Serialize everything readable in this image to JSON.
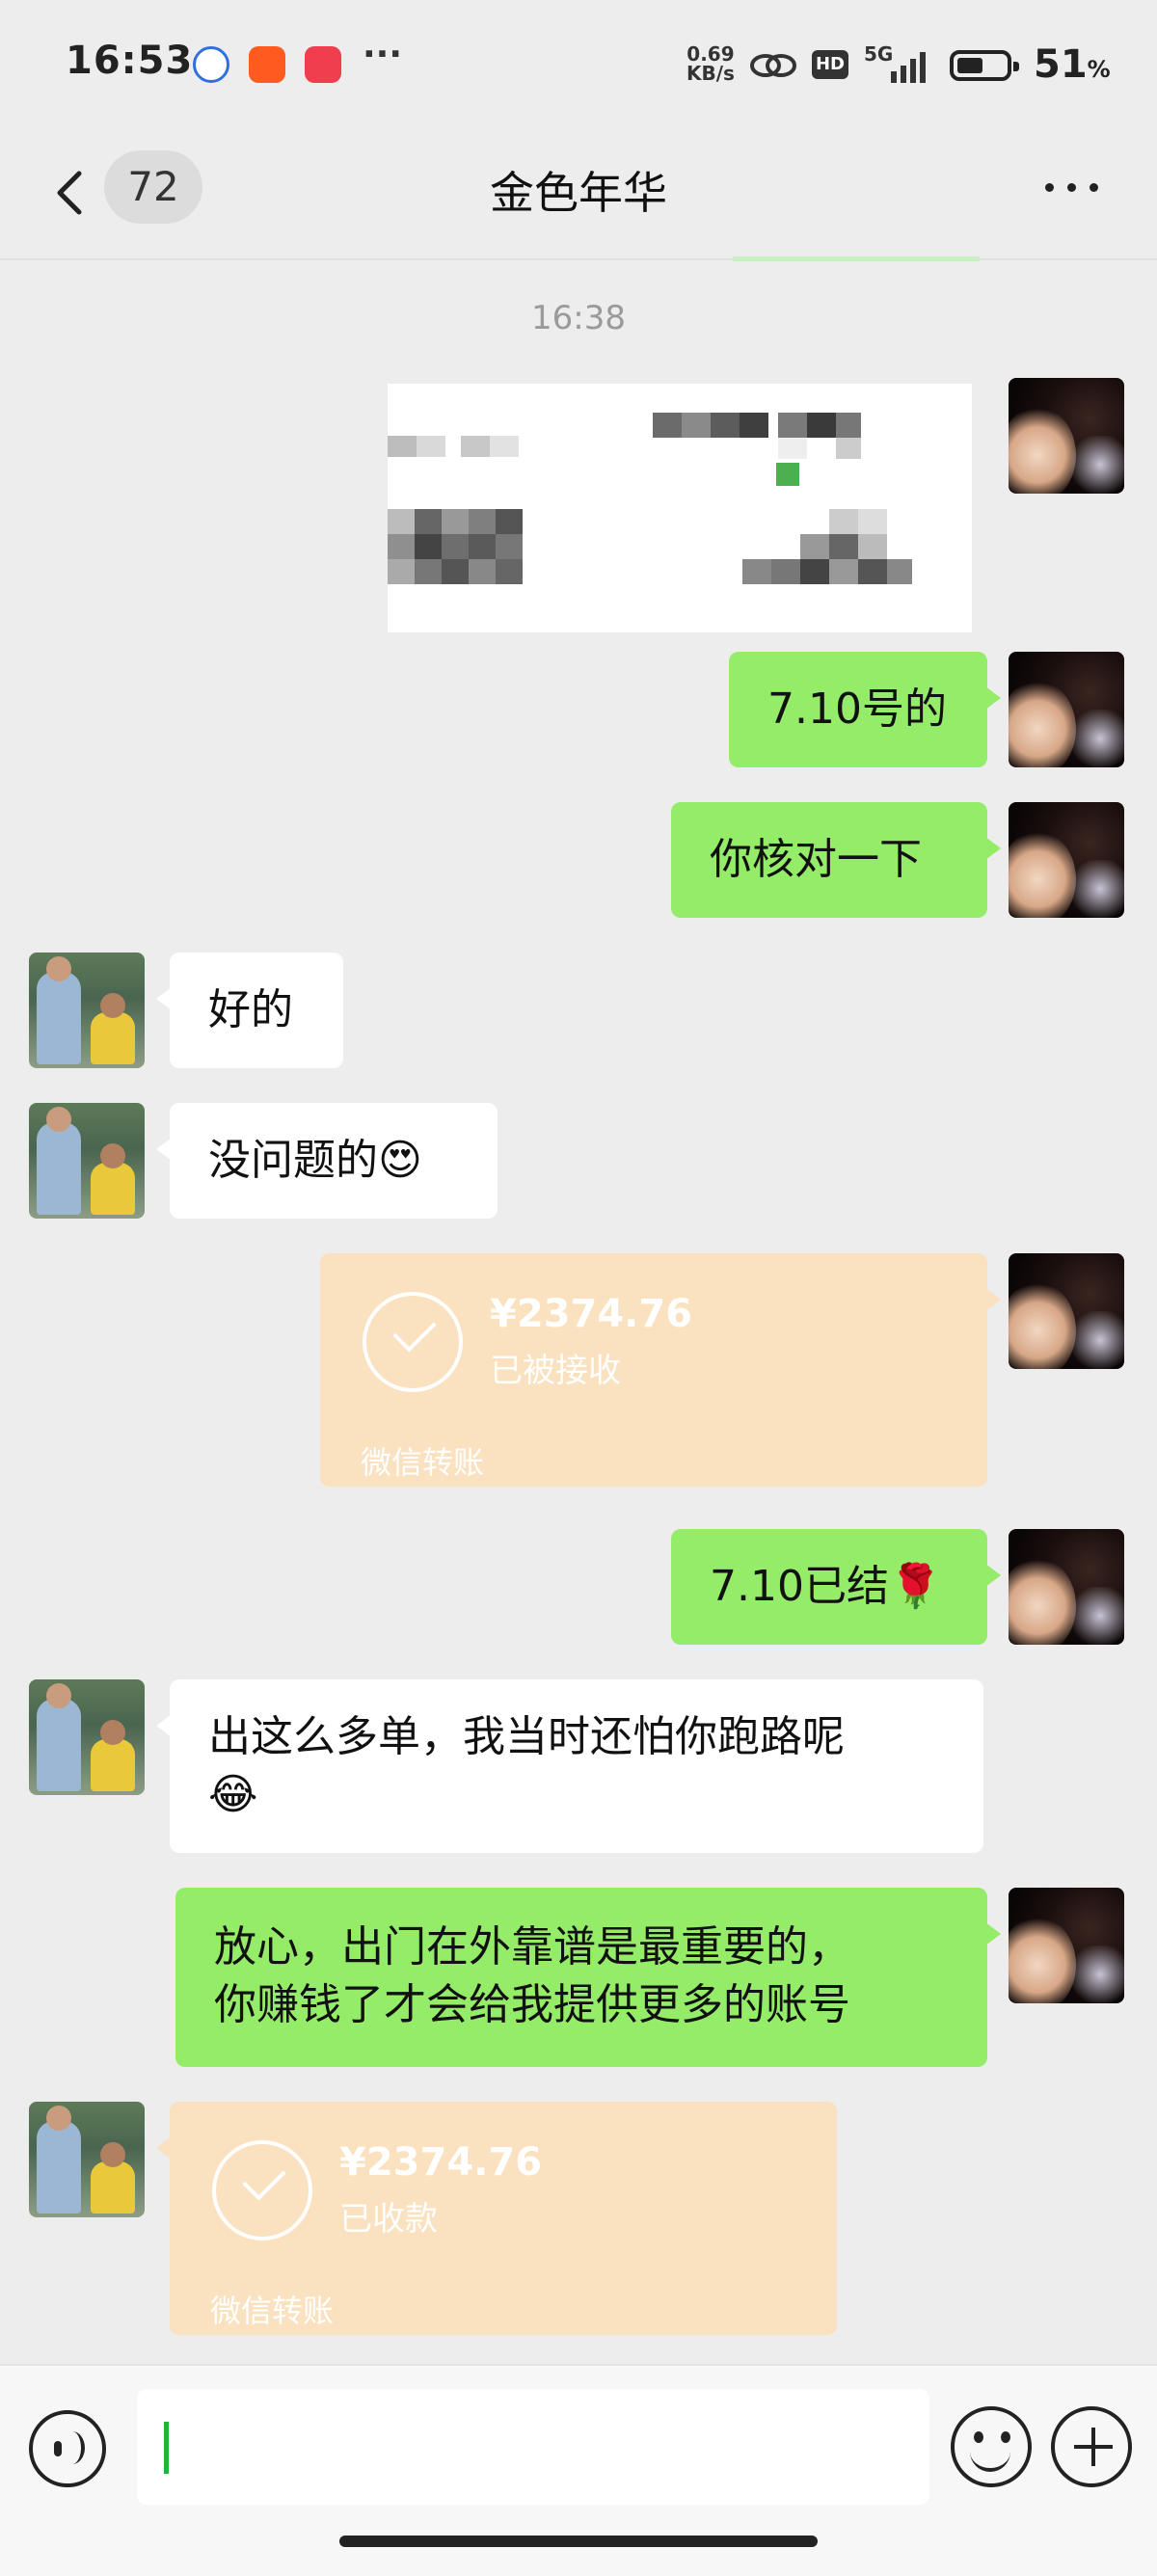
{
  "status_bar": {
    "time": "16:53",
    "more": "···",
    "net_speed": "0.69",
    "net_unit": "KB/s",
    "hd": "HD",
    "signal": "5G",
    "battery_pct": "51",
    "battery_unit": "%"
  },
  "nav": {
    "unread_count": "72",
    "title": "金色年华"
  },
  "chat": {
    "timestamp": "16:38",
    "messages": [
      {
        "sender": "me",
        "type": "image"
      },
      {
        "sender": "me",
        "type": "text",
        "text": "7.10号的"
      },
      {
        "sender": "me",
        "type": "text",
        "text": "你核对一下"
      },
      {
        "sender": "other",
        "type": "text",
        "text": "好的"
      },
      {
        "sender": "other",
        "type": "text",
        "text": "没问题的",
        "emoji": "😍"
      },
      {
        "sender": "me",
        "type": "transfer",
        "amount": "¥2374.76",
        "status": "已被接收",
        "label": "微信转账"
      },
      {
        "sender": "me",
        "type": "text",
        "text": "7.10已结",
        "emoji": "🌹"
      },
      {
        "sender": "other",
        "type": "text",
        "text": "出这么多单，我当时还怕你跑路呢",
        "emoji": "😂"
      },
      {
        "sender": "me",
        "type": "text",
        "line1": "放心，出门在外靠谱是最重要的，",
        "line2": "你赚钱了才会给我提供更多的账号"
      },
      {
        "sender": "other",
        "type": "transfer",
        "amount": "¥2374.76",
        "status": "已收款",
        "label": "微信转账"
      }
    ]
  },
  "colors": {
    "my_bubble": "#95ec69",
    "their_bubble": "#ffffff",
    "transfer_bubble": "#fae1bf",
    "background": "#ededed"
  }
}
